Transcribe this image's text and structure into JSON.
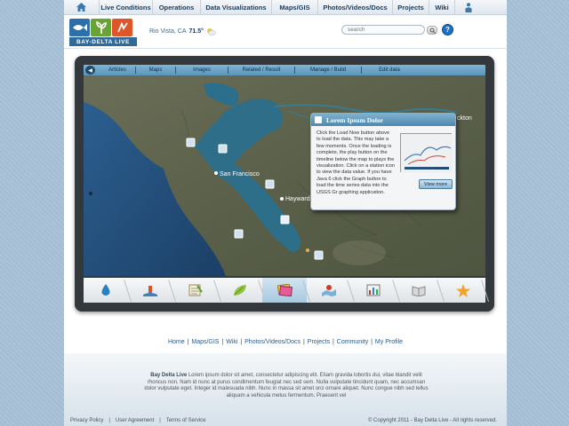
{
  "topnav": {
    "items": [
      "Live Conditions",
      "Operations",
      "Data Visualizations",
      "Maps/GIS",
      "Photos/Videos/Docs",
      "Projects",
      "Wiki"
    ],
    "home_icon": "home-icon",
    "people_icon": "people-icon"
  },
  "header": {
    "logo_text": "BAY-DELTA LIVE",
    "location": "Rio Vista, CA",
    "temperature": "71.5°",
    "search_placeholder": "search",
    "help_label": "?"
  },
  "subnav": {
    "items": [
      "Articles",
      "Maps",
      "Images",
      "Related / Result",
      "Manage / Build",
      "Edit data"
    ]
  },
  "map": {
    "labels": {
      "san_francisco": "San Francisco",
      "hayward": "Hayward",
      "stockton": "ckton"
    }
  },
  "popup": {
    "title": "Lorem Ipsum Dolor",
    "body": "Click the Load Now button above to load the data. This may take a few moments. Once the loading is complete, the play button on the timeline below the map to plays the visualization. Click on a station icon to view the data value. If you have Java 6 click the Graph button to load the time series data into the USGS Gr graphing application.",
    "button_label": "View more"
  },
  "toolbar": {
    "icons": [
      "water-drop-icon",
      "buoy-icon",
      "checklist-icon",
      "leaf-icon",
      "layers-icon",
      "map-pin-icon",
      "chart-icon",
      "book-icon",
      "star-icon"
    ],
    "active_index": 4
  },
  "footer": {
    "nav": [
      "Home",
      "Maps/GIS",
      "Wiki",
      "Photos/Videos/Docs",
      "Projects",
      "Community",
      "My Profile"
    ],
    "desc_brand": "Bay Delta Live",
    "desc_text": "Lorem ipsum dolor sit amet, consectetur adipiscing elit. Etiam gravida lobortis dui, vitae blandit velit rhoncus non. Nam id nunc at purus condimentum feugiat nec sed sem. Nulla vulputate tincidunt quam, nec accumsan dolor vulputate eget. Integer id malesuada nibh. Nunc in massa sit amet orci ornare aliquet. Nunc congue nibh sed tellus aliquam a vehicula metus fermentum. Praesent vel",
    "links": [
      "Privacy Policy",
      "User Agreement",
      "Terms of Service"
    ],
    "copyright": "© Copyright 2011 - Bay Delta Live - All rights reserved."
  },
  "colors": {
    "accent": "#2e6b9a",
    "nav_text": "#1d3a58",
    "subnav_bg": "#6aa3c6",
    "water": "#1f4d74",
    "land": "#5e6452"
  }
}
